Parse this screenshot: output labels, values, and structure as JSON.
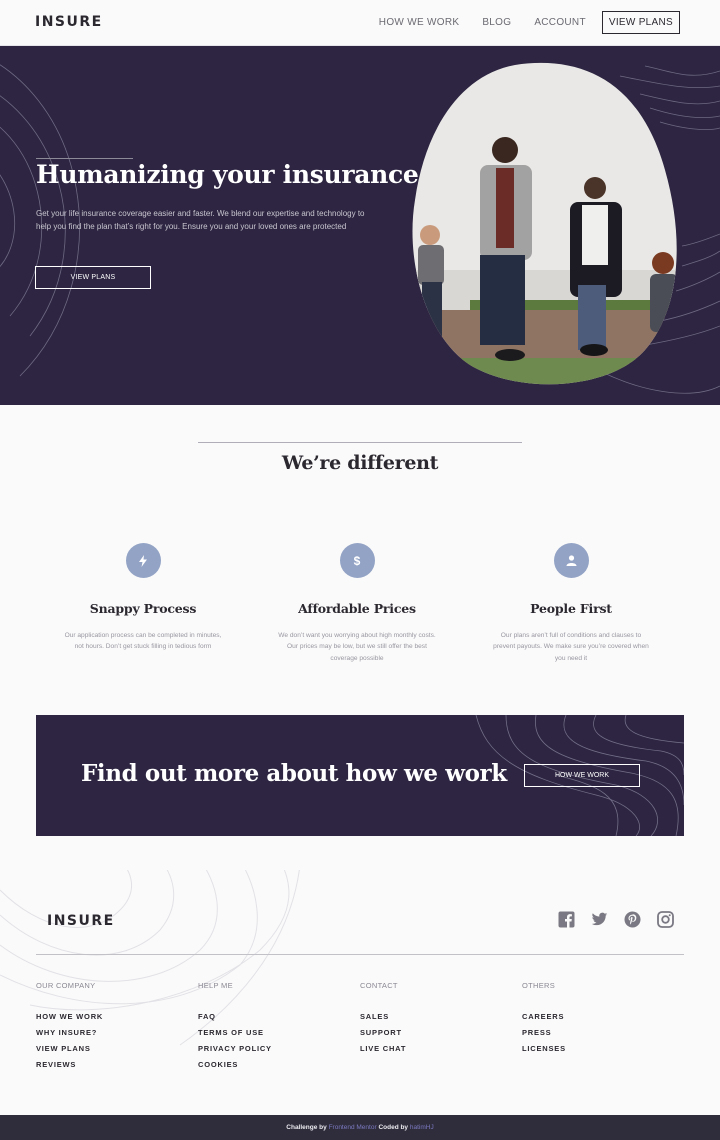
{
  "header": {
    "logo": "INSURE",
    "nav": [
      {
        "label": "HOW WE WORK"
      },
      {
        "label": "BLOG"
      },
      {
        "label": "ACCOUNT"
      }
    ],
    "cta_label": "VIEW PLANS"
  },
  "hero": {
    "title": "Humanizing your insurance",
    "text": "Get your life insurance coverage easier and faster. We blend our expertise and technology to help you find the plan that’s right for you. Ensure you and your loved ones are protected",
    "button_label": "VIEW PLANS",
    "image_alt": "Family of four holding hands and dancing on a sidewalk"
  },
  "features": {
    "title": "We’re different",
    "items": [
      {
        "icon": "lightning-icon",
        "glyph": "⚡",
        "title": "Snappy Process",
        "text": "Our application process can be completed in minutes, not hours. Don’t get stuck filling in tedious form"
      },
      {
        "icon": "dollar-icon",
        "glyph": "$",
        "title": "Affordable Prices",
        "text": "We don’t want you worrying about high monthly costs. Our prices may be low, but we still offer the best coverage possible"
      },
      {
        "icon": "person-icon",
        "glyph": "●",
        "title": "People First",
        "text": "Our plans aren’t full of conditions and clauses to prevent payouts. We make sure you’re covered when you need it"
      }
    ]
  },
  "cta": {
    "title": "Find out more about how we work",
    "button_label": "HOW WE WORK"
  },
  "footer": {
    "logo": "INSURE",
    "socials": [
      "facebook",
      "twitter",
      "pinterest",
      "instagram"
    ],
    "columns": [
      {
        "heading": "OUR COMPANY",
        "links": [
          "HOW WE WORK",
          "WHY INSURE?",
          "VIEW PLANS",
          "REVIEWS"
        ]
      },
      {
        "heading": "HELP ME",
        "links": [
          "FAQ",
          "TERMS OF USE",
          "PRIVACY POLICY",
          "COOKIES"
        ]
      },
      {
        "heading": "CONTACT",
        "links": [
          "SALES",
          "SUPPORT",
          "LIVE CHAT"
        ]
      },
      {
        "heading": "OTHERS",
        "links": [
          "CAREERS",
          "PRESS",
          "LICENSES"
        ]
      }
    ]
  },
  "attribution": {
    "prefix": "Challenge by",
    "challenge_link": "Frontend Mentor",
    "middle": "Coded by",
    "author_link": "hatimHJ"
  },
  "colors": {
    "dark_violet": "#2d2541",
    "icon_blue": "#93a3c5",
    "text_dark": "#2c2830",
    "footer_bar": "#2f2d3c"
  }
}
